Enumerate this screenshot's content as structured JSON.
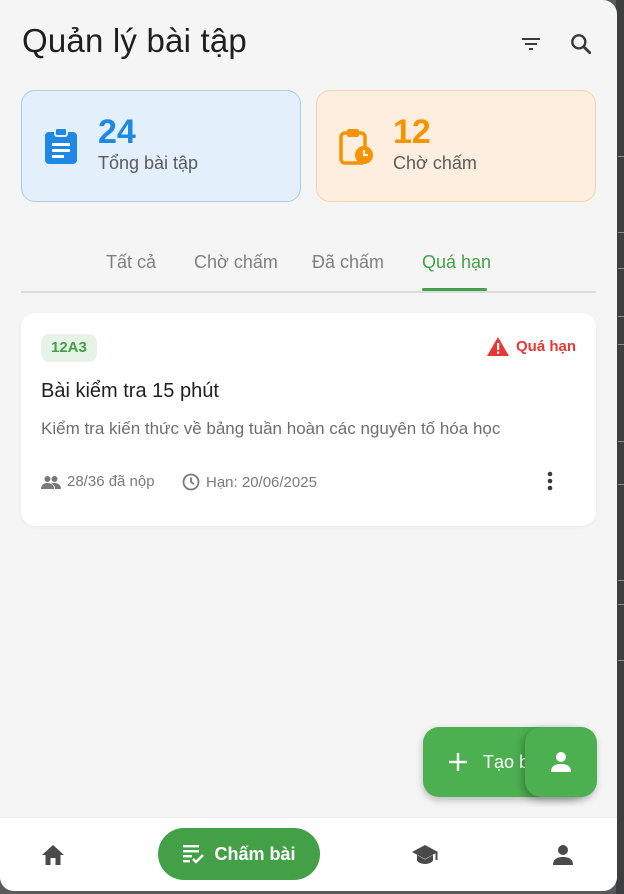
{
  "header": {
    "title": "Quản lý bài tập",
    "filter_icon": "filter-icon",
    "search_icon": "search-icon"
  },
  "stats": [
    {
      "value": "24",
      "label": "Tổng bài tập",
      "icon": "clipboard-icon",
      "color": "#1e88e5"
    },
    {
      "value": "12",
      "label": "Chờ chấm",
      "icon": "clipboard-clock-icon",
      "color": "#f59300"
    }
  ],
  "tabs": [
    {
      "label": "Tất cả",
      "active": false
    },
    {
      "label": "Chờ chấm",
      "active": false
    },
    {
      "label": "Đã chấm",
      "active": false
    },
    {
      "label": "Quá hạn",
      "active": true
    }
  ],
  "assignment": {
    "class": "12A3",
    "status": "Quá hạn",
    "title": "Bài kiểm tra 15 phút",
    "description": "Kiểm tra kiến thức về bảng tuần hoàn các nguyên tố hóa học",
    "submitted": "28/36 đã nộp",
    "due": "Hạn: 20/06/2025"
  },
  "fab": {
    "label": "Tạo b",
    "icon": "plus-icon"
  },
  "bottom_nav": {
    "grading_label": "Chấm bài",
    "items": [
      "home-icon",
      "grading-icon",
      "school-icon",
      "person-icon"
    ]
  },
  "colors": {
    "accent": "#43a047",
    "overdue": "#e53935",
    "total_blue": "#1e88e5",
    "pending_orange": "#f59300"
  }
}
